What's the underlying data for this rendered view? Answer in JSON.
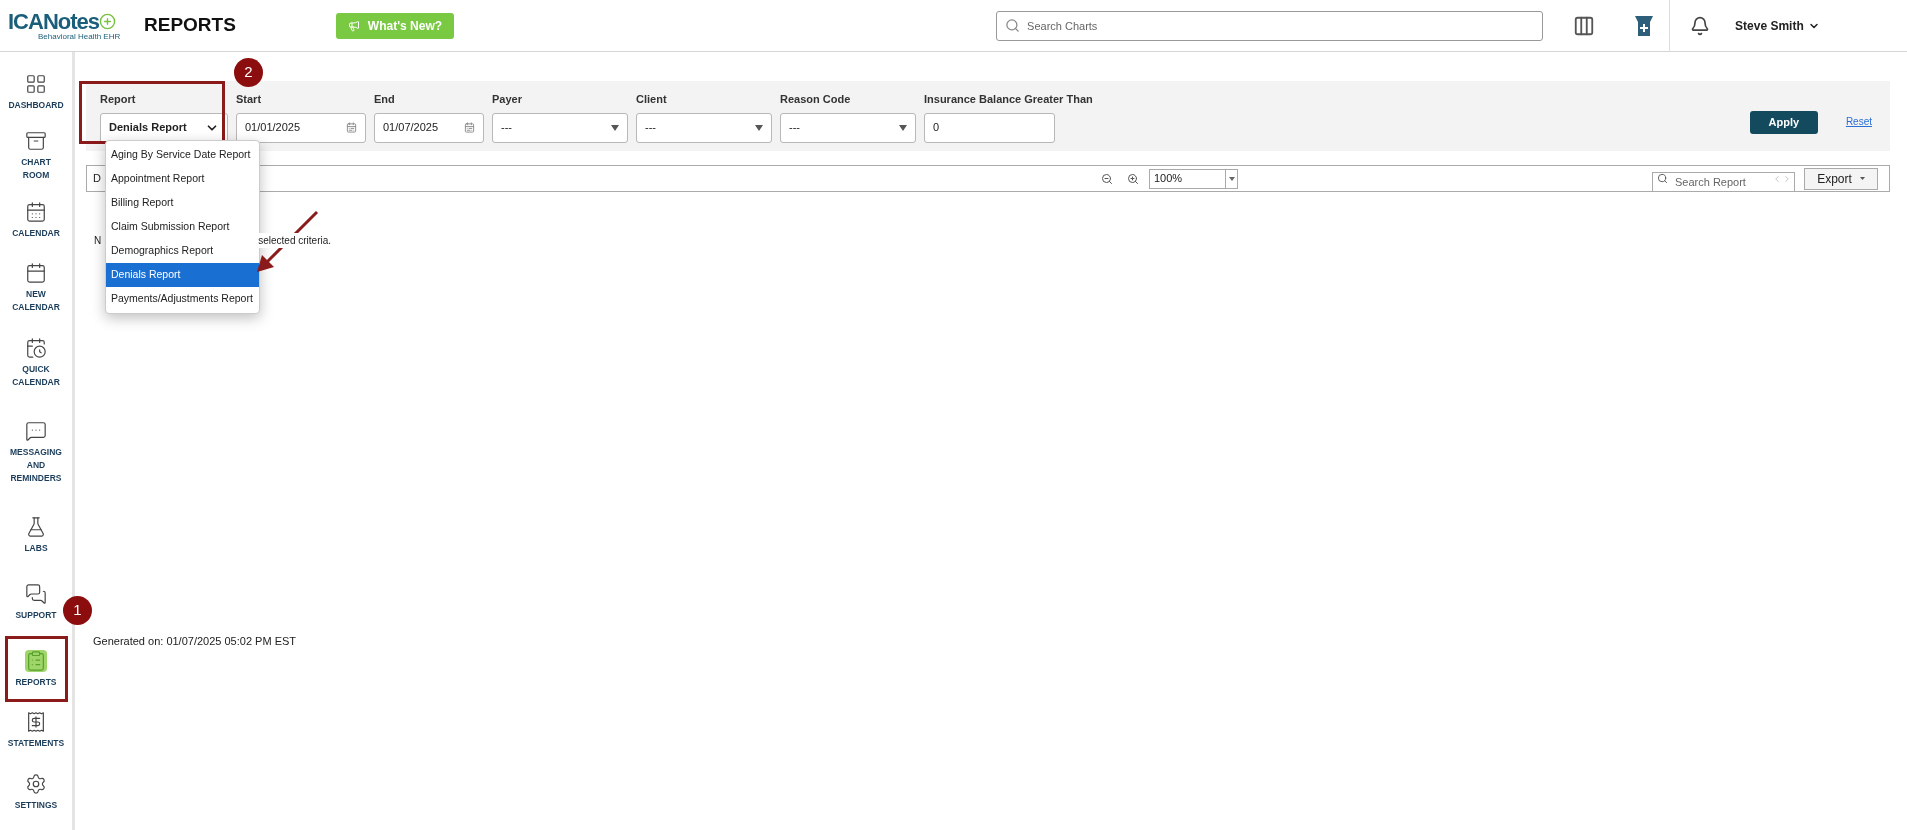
{
  "header": {
    "logo": {
      "brand": "ICANotes",
      "tagline": "Behavioral Health EHR"
    },
    "title": "REPORTS",
    "whats_new": "What's New?",
    "search": {
      "placeholder": "Search Charts"
    },
    "user": "Steve Smith"
  },
  "sidebar": {
    "items": [
      {
        "label": "DASHBOARD",
        "selected": false
      },
      {
        "label": "CHART ROOM",
        "selected": false
      },
      {
        "label": "CALENDAR",
        "selected": false
      },
      {
        "label": "NEW\nCALENDAR",
        "selected": false
      },
      {
        "label": "QUICK\nCALENDAR",
        "selected": false
      },
      {
        "label": "MESSAGING\nAND\nREMINDERS",
        "selected": false
      },
      {
        "label": "LABS",
        "selected": false
      },
      {
        "label": "SUPPORT",
        "selected": false
      },
      {
        "label": "REPORTS",
        "selected": true
      },
      {
        "label": "STATEMENTS",
        "selected": false
      },
      {
        "label": "SETTINGS",
        "selected": false
      }
    ]
  },
  "filters": [
    {
      "kind": "select",
      "label": "Report",
      "value": "Denials Report"
    },
    {
      "kind": "date",
      "label": "Start",
      "value": "01/01/2025"
    },
    {
      "kind": "date",
      "label": "End",
      "value": "01/07/2025"
    },
    {
      "kind": "combo",
      "label": "Payer",
      "value": "---"
    },
    {
      "kind": "combo",
      "label": "Client",
      "value": "---"
    },
    {
      "kind": "combo",
      "label": "Reason Code",
      "value": "---"
    },
    {
      "kind": "text",
      "label": "Insurance Balance Greater Than",
      "value": "0"
    }
  ],
  "apply": "Apply",
  "reset": "Reset",
  "report_menu": [
    {
      "label": "Aging By Service Date Report",
      "selected": false
    },
    {
      "label": "Appointment Report",
      "selected": false
    },
    {
      "label": "Billing Report",
      "selected": false
    },
    {
      "label": "Claim Submission Report",
      "selected": false
    },
    {
      "label": "Demographics Report",
      "selected": false
    },
    {
      "label": "Denials Report",
      "selected": true
    },
    {
      "label": "Payments/Adjustments Report",
      "selected": false
    }
  ],
  "viewer": {
    "toolbar_text": "D",
    "zoom": "100%",
    "search": {
      "placeholder": "Search Report"
    },
    "export": "Export",
    "message_start": "N",
    "message_end": "selected criteria.",
    "generated": "Generated on: 01/07/2025 05:02 PM EST"
  },
  "callouts": [
    "1",
    "2"
  ]
}
